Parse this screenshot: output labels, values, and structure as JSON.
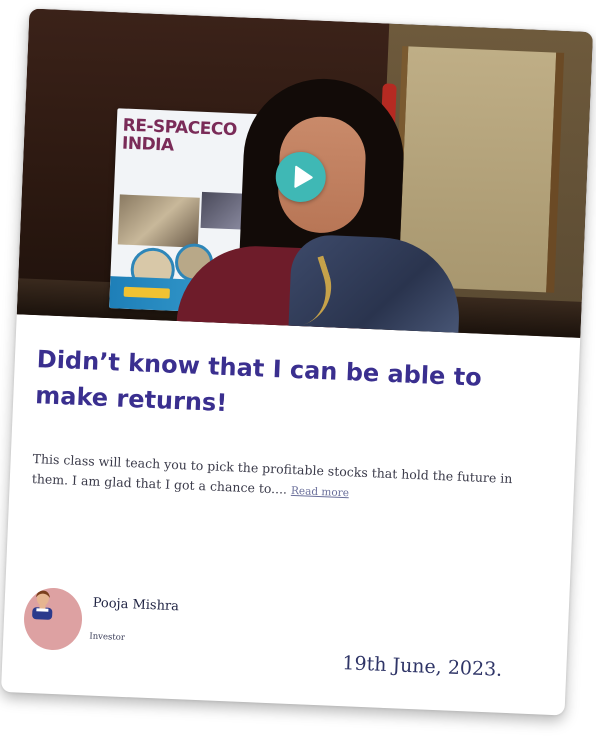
{
  "testimonial": {
    "video": {
      "banner_text": "RE-SPACECO INDIA",
      "play_icon": "play-icon"
    },
    "title": "Didn’t know that I can be able to make returns!",
    "description": "This class will teach you to pick the profitable stocks that hold the future in them. I am glad that I got a chance to....",
    "read_more": "Read more",
    "author": {
      "name": "Pooja Mishra",
      "role": "Investor",
      "avatar_icon": "user-avatar-icon"
    },
    "date": "19th June, 2023."
  },
  "colors": {
    "title": "#3a2f8f",
    "play_button": "#3fb8b5",
    "avatar_bg": "#dda1a2",
    "date": "#2f3567",
    "banner_title": "#7a2b58"
  }
}
